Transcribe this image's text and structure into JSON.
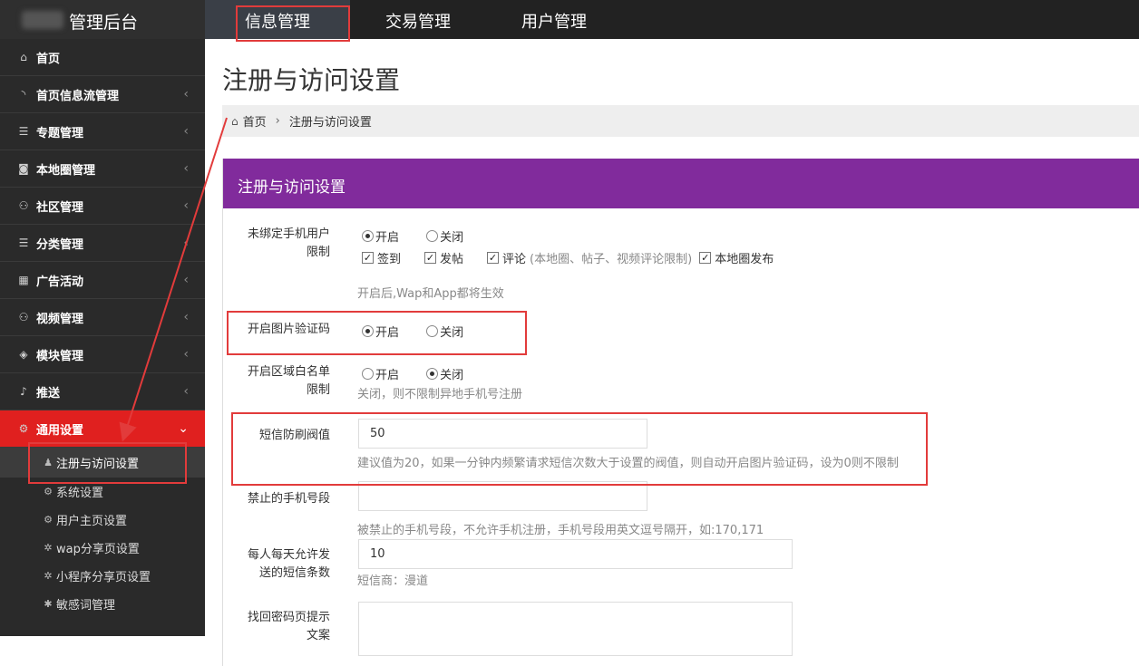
{
  "brand": {
    "title": "管理后台"
  },
  "topnav": [
    {
      "label": "信息管理",
      "active": true
    },
    {
      "label": "交易管理",
      "active": false
    },
    {
      "label": "用户管理",
      "active": false
    }
  ],
  "sidebar": {
    "items": [
      {
        "label": "首页",
        "icon": "home-icon",
        "glyph": "⌂",
        "has_chevron": false
      },
      {
        "label": "首页信息流管理",
        "icon": "rss-icon",
        "glyph": "◝",
        "has_chevron": true
      },
      {
        "label": "专题管理",
        "icon": "list-icon",
        "glyph": "☰",
        "has_chevron": true
      },
      {
        "label": "本地圈管理",
        "icon": "camera-icon",
        "glyph": "◙",
        "has_chevron": true
      },
      {
        "label": "社区管理",
        "icon": "users-icon",
        "glyph": "⚇",
        "has_chevron": true
      },
      {
        "label": "分类管理",
        "icon": "list-icon",
        "glyph": "☰",
        "has_chevron": true
      },
      {
        "label": "广告活动",
        "icon": "calendar-icon",
        "glyph": "▦",
        "has_chevron": true
      },
      {
        "label": "视频管理",
        "icon": "users-icon",
        "glyph": "⚇",
        "has_chevron": true
      },
      {
        "label": "模块管理",
        "icon": "cubes-icon",
        "glyph": "◈",
        "has_chevron": true
      },
      {
        "label": "推送",
        "icon": "bell-icon",
        "glyph": "♪",
        "has_chevron": true
      },
      {
        "label": "通用设置",
        "icon": "gears-icon",
        "glyph": "⚙",
        "has_chevron": true,
        "active": true
      }
    ],
    "sub_items": [
      {
        "label": "注册与访问设置",
        "icon": "user-icon",
        "glyph": "♟",
        "active": true
      },
      {
        "label": "系统设置",
        "icon": "gears-icon",
        "glyph": "⚙"
      },
      {
        "label": "用户主页设置",
        "icon": "gears-icon",
        "glyph": "⚙"
      },
      {
        "label": "wap分享页设置",
        "icon": "gear-icon",
        "glyph": "✲"
      },
      {
        "label": "小程序分享页设置",
        "icon": "gear-icon",
        "glyph": "✲"
      },
      {
        "label": "敏感词管理",
        "icon": "asterisk-icon",
        "glyph": "✱"
      }
    ]
  },
  "page": {
    "title": "注册与访问设置",
    "breadcrumb": {
      "home": "首页",
      "current": "注册与访问设置"
    },
    "panel_title": "注册与访问设置"
  },
  "form": {
    "unbound": {
      "label_line1": "未绑定手机用户",
      "label_line2": "限制",
      "on": "开启",
      "off": "关闭",
      "checks": [
        "签到",
        "发帖",
        "评论",
        "本地圈发布"
      ],
      "comment_note": "(本地圈、帖子、视频评论限制)",
      "hint": "开启后,Wap和App都将生效"
    },
    "captcha": {
      "label": "开启图片验证码",
      "on": "开启",
      "off": "关闭"
    },
    "region": {
      "label_line1": "开启区域白名单",
      "label_line2": "限制",
      "on": "开启",
      "off": "关闭",
      "hint": "关闭，则不限制异地手机号注册"
    },
    "sms_threshold": {
      "label": "短信防刷阀值",
      "value": "50",
      "hint": "建议值为20，如果一分钟内频繁请求短信次数大于设置的阀值，则自动开启图片验证码，设为0则不限制"
    },
    "banned_numbers": {
      "label": "禁止的手机号段",
      "value": "",
      "hint": "被禁止的手机号段，不允许手机注册，手机号段用英文逗号隔开，如:170,171"
    },
    "daily_sms": {
      "label_line1": "每人每天允许发",
      "label_line2": "送的短信条数",
      "value": "10",
      "hint": "短信商：漫道"
    },
    "recover_tip": {
      "label_line1": "找回密码页提示",
      "label_line2": "文案"
    }
  }
}
